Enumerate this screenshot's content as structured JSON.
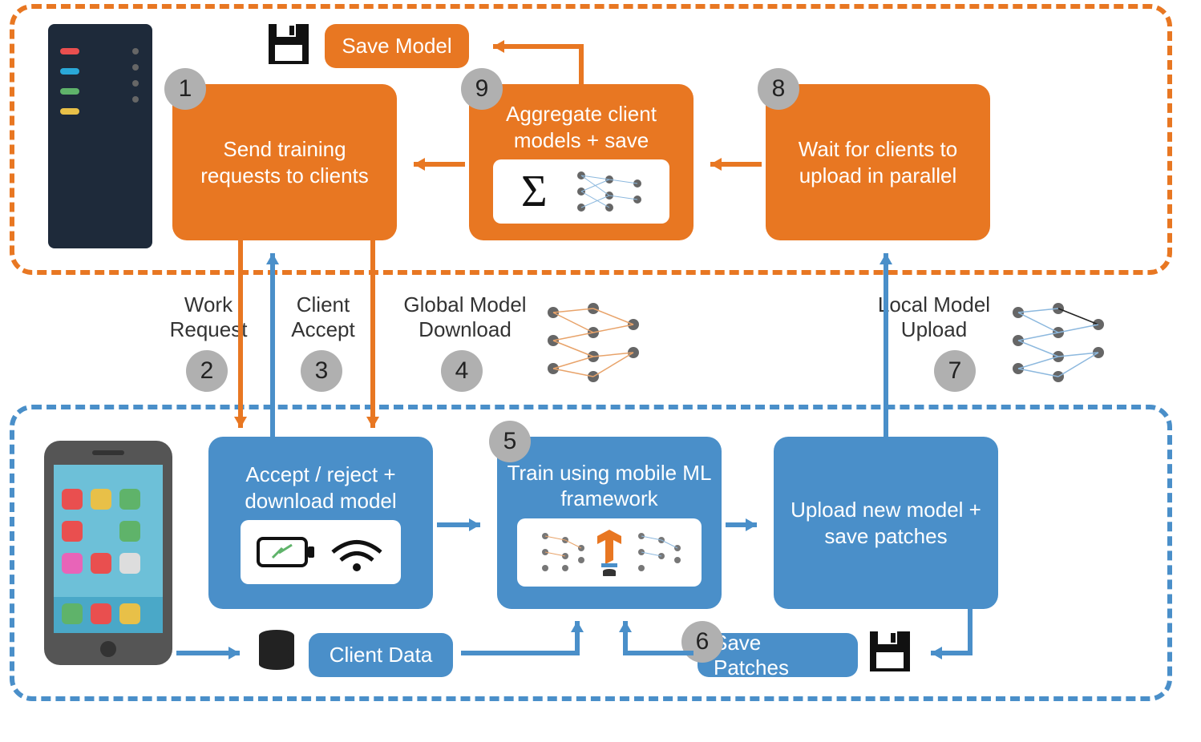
{
  "steps": {
    "s1": {
      "num": "1",
      "text": "Send training requests to clients"
    },
    "s2": {
      "num": "2",
      "label": "Work Request"
    },
    "s3": {
      "num": "3",
      "label": "Client Accept"
    },
    "s4": {
      "num": "4",
      "label": "Global Model Download"
    },
    "s5": {
      "num": "5",
      "text": "Train using mobile ML framework"
    },
    "s6": {
      "num": "6",
      "text": "Save Patches"
    },
    "s7": {
      "num": "7",
      "label": "Local Model Upload"
    },
    "s8": {
      "num": "8",
      "text": "Wait for clients to upload in parallel"
    },
    "s9": {
      "num": "9",
      "text": "Aggregate client models + save"
    }
  },
  "boxes": {
    "save_model": "Save Model",
    "accept_reject": "Accept / reject + download model",
    "upload_new": "Upload new model + save patches",
    "client_data": "Client Data"
  },
  "colors": {
    "orange": "#e87722",
    "blue": "#4a8fc9",
    "gray": "#b0b0b0"
  }
}
